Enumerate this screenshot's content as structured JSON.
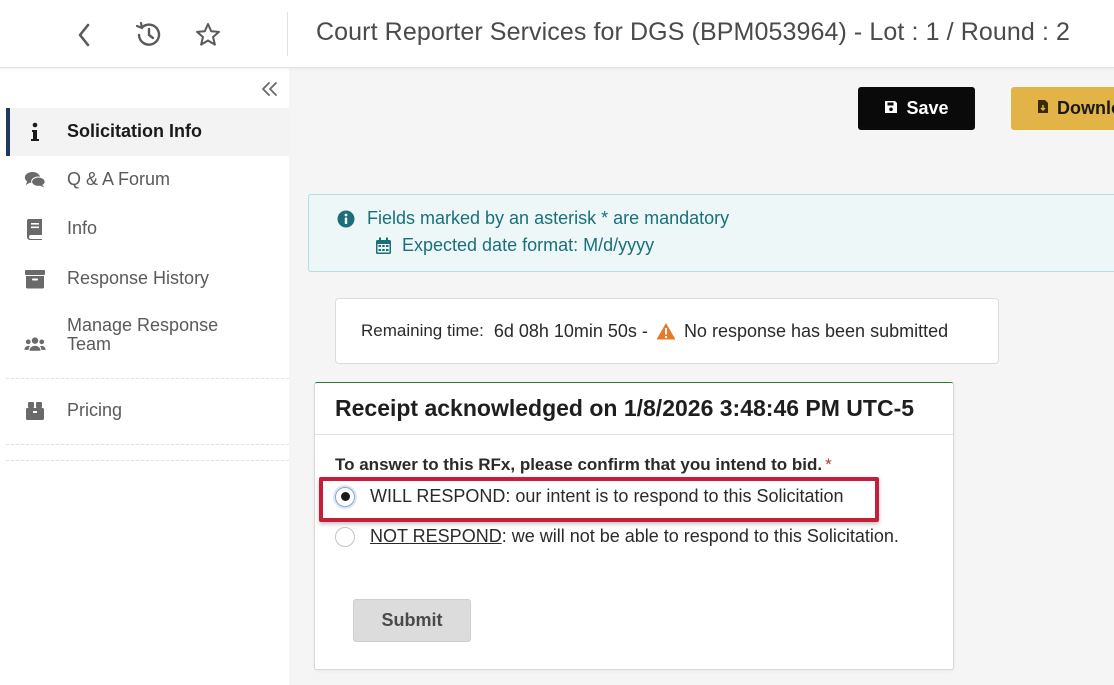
{
  "header": {
    "title": "Court Reporter Services for DGS (BPM053964) - Lot : 1 / Round : 2",
    "back_icon": "chevron-left-icon",
    "history_icon": "history-icon",
    "favorite_icon": "star-icon"
  },
  "sidebar": {
    "collapse_icon": "double-chevron-left-icon",
    "items": [
      {
        "label": "Solicitation Info",
        "icon": "info-icon",
        "active": true
      },
      {
        "label": "Q & A Forum",
        "icon": "comments-icon"
      },
      {
        "label": "Info",
        "icon": "book-icon"
      },
      {
        "label": "Response History",
        "icon": "archive-icon"
      },
      {
        "label": "Manage Response Team",
        "icon": "users-icon"
      },
      {
        "label": "Pricing",
        "icon": "dolly-icon"
      }
    ]
  },
  "toolbar": {
    "save_label": "Save",
    "download_label": "Download"
  },
  "info_box": {
    "mandatory_text": "Fields marked by an asterisk * are mandatory",
    "date_format_text": "Expected date format: M/d/yyyy"
  },
  "timer": {
    "label": "Remaining time:",
    "value": "6d 08h 10min 50s -",
    "status": "No response has been submitted"
  },
  "card": {
    "heading": "Receipt acknowledged on 1/8/2026 3:48:46 PM UTC-5",
    "question": "To answer to this RFx, please confirm that you intend to bid.",
    "required_marker": "*",
    "options": [
      {
        "prefix": "WILL RESPOND",
        "text": ": our intent is to respond to this Solicitation",
        "selected": true
      },
      {
        "prefix": "NOT RESPOND",
        "text": ": we will not be able to respond to this Solicitation.",
        "selected": false
      }
    ],
    "submit_label": "Submit"
  },
  "colors": {
    "accent_dark": "#0a0a0a",
    "download_yellow": "#e2b448",
    "info_teal": "#1a6f7a",
    "highlight_red": "#c41e3a",
    "warning_orange": "#e8792b"
  }
}
